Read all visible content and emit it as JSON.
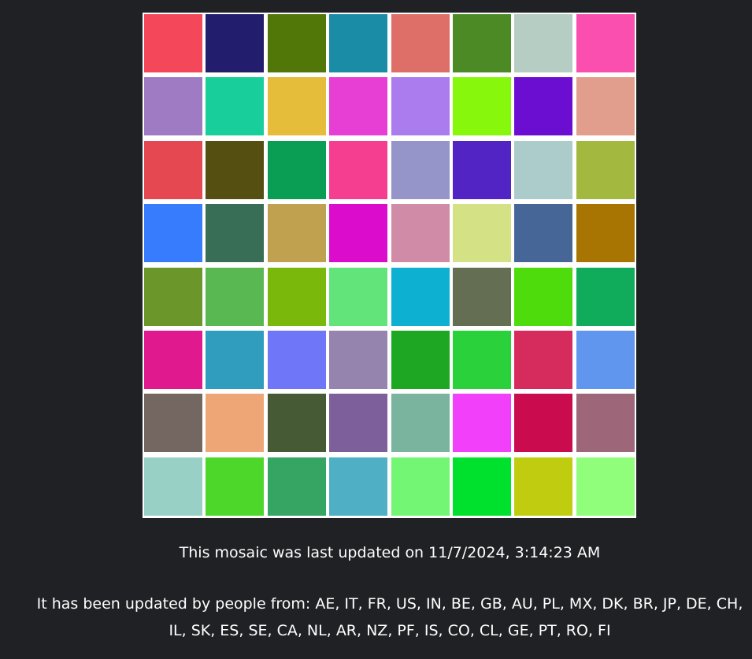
{
  "mosaic": {
    "rows": 8,
    "cols": 8,
    "colors": [
      [
        "#f4475a",
        "#231d6e",
        "#517708",
        "#1a8ca5",
        "#de6e68",
        "#4b8a24",
        "#b6cdc3",
        "#fb4fb0"
      ],
      [
        "#9f7bc4",
        "#18ce9a",
        "#e5bd3a",
        "#e73ed4",
        "#aa7ced",
        "#87f80b",
        "#6b0ed1",
        "#e29e8c"
      ],
      [
        "#e64851",
        "#555012",
        "#0a9d54",
        "#f63e90",
        "#9695c9",
        "#5224c4",
        "#abcccb",
        "#a2b83e"
      ],
      [
        "#387cfe",
        "#386e55",
        "#c0a150",
        "#dc0ccd",
        "#d08ba7",
        "#d4e185",
        "#466697",
        "#a97502"
      ],
      [
        "#6a962a",
        "#5ab853",
        "#7ab80c",
        "#63e47b",
        "#0eb0d2",
        "#646e53",
        "#4edc0c",
        "#10ab5b"
      ],
      [
        "#e0198f",
        "#319dbe",
        "#7076f8",
        "#9585ae",
        "#1ea722",
        "#2ad13a",
        "#d52c5d",
        "#6096ee"
      ],
      [
        "#746761",
        "#efa677",
        "#465a35",
        "#7d609b",
        "#7ab49e",
        "#f23ff9",
        "#ca0c4e",
        "#9e6779"
      ],
      [
        "#98d0c6",
        "#4dd72b",
        "#36a462",
        "#4fafc4",
        "#73f673",
        "#00e12d",
        "#c0cc10",
        "#91fe7b"
      ]
    ]
  },
  "footer": {
    "last_updated": "This mosaic was last updated on 11/7/2024, 3:14:23 AM",
    "contributors": "It has been updated by people from: AE, IT, FR, US, IN, BE, GB, AU, PL, MX, DK, BR, JP, DE, CH, IL, SK, ES, SE, CA, NL, AR, NZ, PF, IS, CO, CL, GE, PT, RO, FI"
  }
}
